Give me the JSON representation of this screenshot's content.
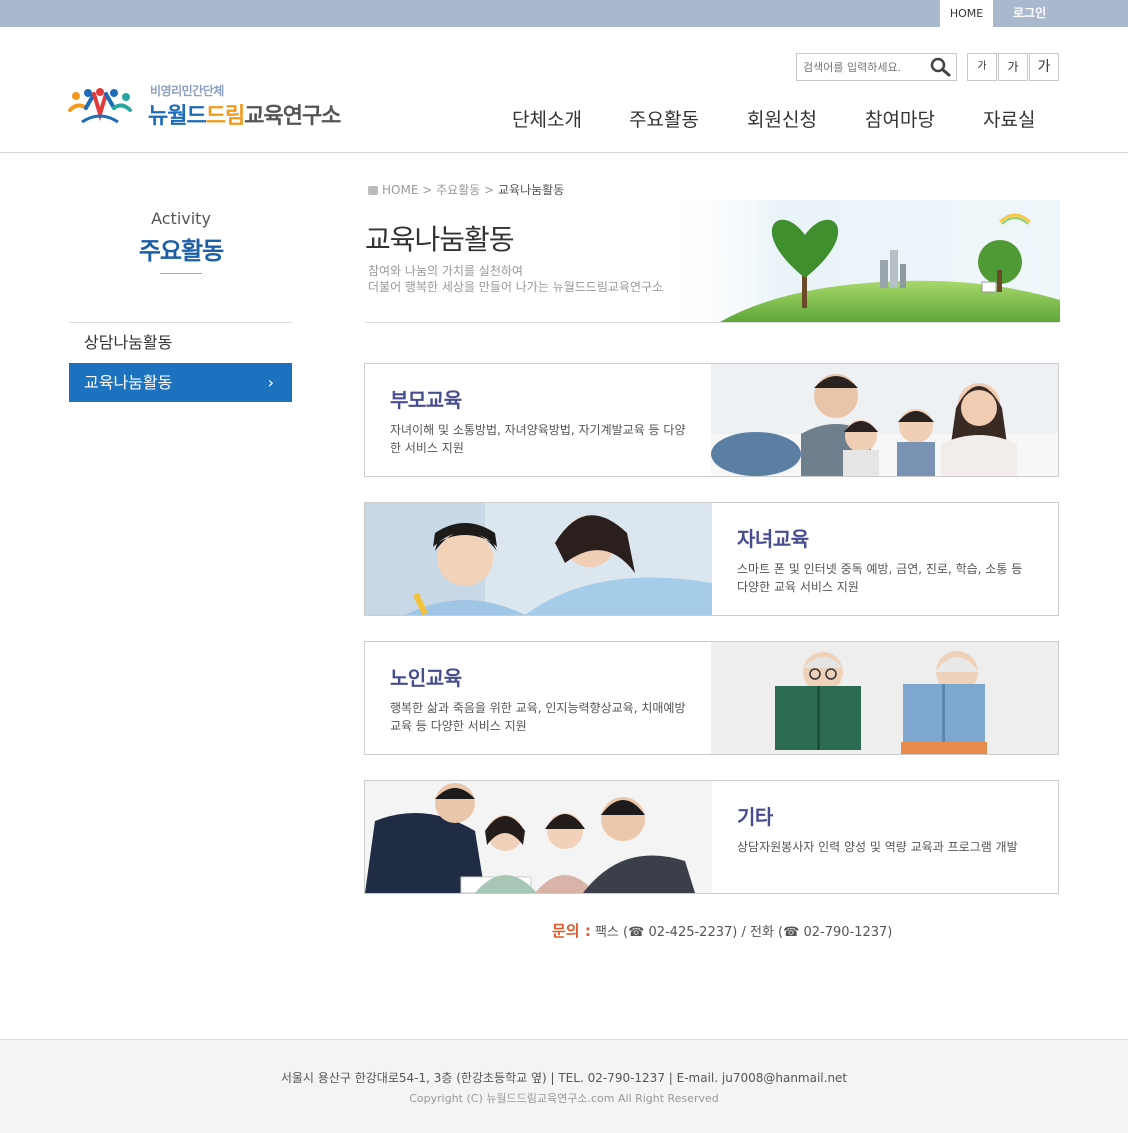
{
  "topbar": {
    "home": "HOME",
    "login": "로그인"
  },
  "logo": {
    "sub": "비영리민간단체",
    "part1": "뉴월드",
    "part2": "드림",
    "part3": "교육연구소"
  },
  "search": {
    "placeholder": "검색어를 입력하세요."
  },
  "font_buttons": [
    "가",
    "가",
    "가"
  ],
  "gnb": [
    "단체소개",
    "주요활동",
    "회원신청",
    "참여마당",
    "자료실"
  ],
  "sidebar": {
    "title_en": "Activity",
    "title_ko": "주요활동",
    "items": [
      {
        "label": "상담나눔활동"
      },
      {
        "label": "교육나눔활동",
        "arrow": "›"
      }
    ]
  },
  "breadcrumb": {
    "home": "HOME",
    "sep": ">",
    "level1": "주요활동",
    "current": "교육나눔활동"
  },
  "page": {
    "title": "교육나눔활동",
    "desc1": "참여와 나눔의 가치를 실천하여",
    "desc2": "더불어 행복한 세상을 만들어 나가는 뉴월드드림교육연구소"
  },
  "cards": [
    {
      "title": "부모교육",
      "desc": "자녀이해 및 소통방법, 자녀양육방법, 자기계발교육 등 다양한 서비스 지원"
    },
    {
      "title": "자녀교육",
      "desc": "스마트 폰 및 인터넷 중독 예방, 금연, 진로, 학습, 소통 등 다양한 교육 서비스 지원"
    },
    {
      "title": "노인교육",
      "desc": "행복한 삶과 죽음을 위한 교육, 인지능력향상교육, 치매예방교육 등 다양한 서비스 지원"
    },
    {
      "title": "기타",
      "desc": "상담자원봉사자 인력 양성 및 역량 교육과 프로그램 개발"
    }
  ],
  "contact": {
    "label": "문의 :",
    "fax_label": "팩스 (",
    "fax": "02-425-2237)",
    "sep": " / ",
    "tel_label": "전화 (",
    "tel": "02-790-1237)"
  },
  "footer": {
    "address": "서울시 용산구 한강대로54-1, 3층 (한강초등학교 옆)  |  TEL. 02-790-1237  |  E-mail. ju7008@hanmail.net",
    "copyright": "Copyright (C) 뉴월드드림교육연구소.com All Right Reserved"
  },
  "colors": {
    "topbar": "#a9b8cc",
    "accent": "#1d72c0",
    "card_title": "#464e8f",
    "contact_label": "#e05a2b"
  }
}
